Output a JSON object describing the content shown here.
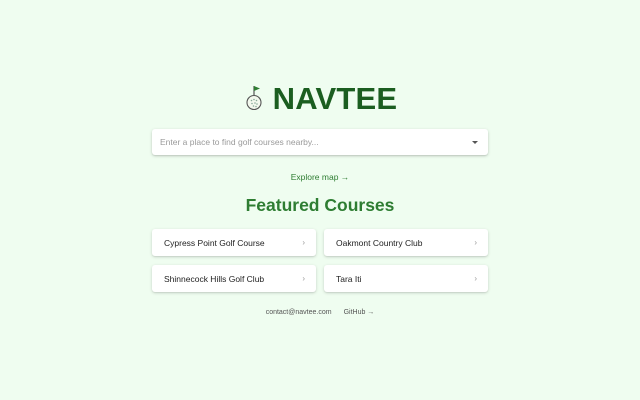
{
  "brand": {
    "icon": "golf-ball-flag-icon",
    "title": "NAVTEE",
    "color": "#1b5e20"
  },
  "search": {
    "placeholder": "Enter a place to find golf courses nearby...",
    "value": ""
  },
  "explore": {
    "label": "Explore map →"
  },
  "featured": {
    "title": "Featured Courses",
    "courses": [
      {
        "name": "Cypress Point Golf Course",
        "icon": "chevron-right-icon"
      },
      {
        "name": "Oakmont Country Club",
        "icon": "chevron-right-icon"
      },
      {
        "name": "Shinnecock Hills Golf Club",
        "icon": "chevron-right-icon"
      },
      {
        "name": "Tara Iti",
        "icon": "chevron-right-icon"
      }
    ]
  },
  "footer": {
    "contact": "contact@navtee.com",
    "github": "GitHub →"
  },
  "colors": {
    "background": "#effdf0",
    "accent": "#2e7d32"
  }
}
